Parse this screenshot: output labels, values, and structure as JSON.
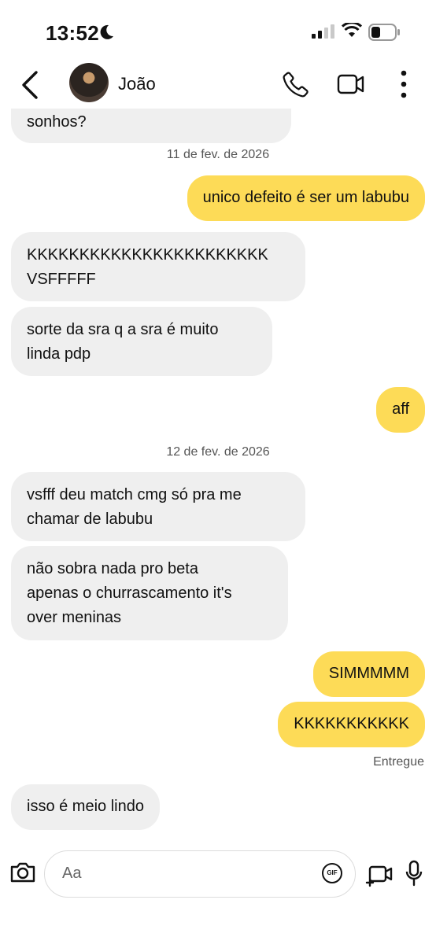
{
  "status_bar": {
    "time": "13:52"
  },
  "header": {
    "contact_name": "João"
  },
  "messages": [
    {
      "text": "sonhos?"
    },
    {
      "text": "unico defeito é ser um labubu"
    },
    {
      "text": "KKKKKKKKKKKKKKKKKKKKKKK\nVSFFFFF"
    },
    {
      "text": "sorte da sra q a sra é muito\nlinda pdp"
    },
    {
      "text": "aff"
    },
    {
      "text": "vsfff deu match cmg só pra me\nchamar de labubu"
    },
    {
      "text": "não sobra nada pro beta\napenas o churrascamento it's\nover meninas"
    },
    {
      "text": "SIMMMMM"
    },
    {
      "text": "KKKKKKKKKKK"
    },
    {
      "text": "isso é meio lindo"
    }
  ],
  "dates": [
    "11 de fev. de 2026",
    "12 de fev. de 2026"
  ],
  "delivered_label": "Entregue",
  "composer": {
    "placeholder": "Aa",
    "gif_label": "GIF"
  },
  "colors": {
    "outgoing_bubble": "#fddb57",
    "incoming_bubble": "#efefef"
  }
}
